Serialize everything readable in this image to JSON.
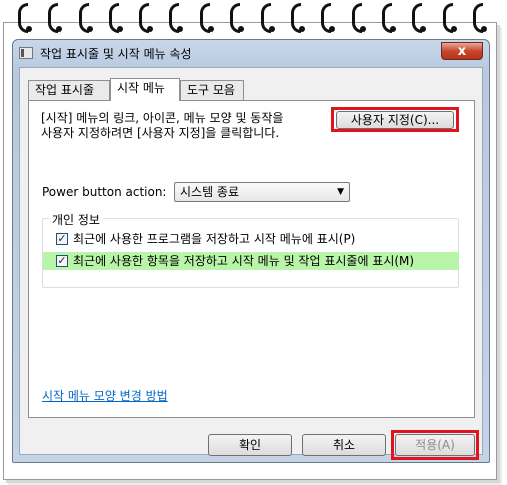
{
  "dialog": {
    "title": "작업 표시줄 및 시작 메뉴 속성",
    "close_glyph": "x"
  },
  "tabs": [
    {
      "label": "작업 표시줄"
    },
    {
      "label": "시작 메뉴"
    },
    {
      "label": "도구 모음"
    }
  ],
  "start_menu": {
    "intro_line1": "[시작] 메뉴의 링크, 아이콘, 메뉴 모양 및 동작을",
    "intro_line2": "사용자 지정하려면 [사용자 지정]을 클릭합니다.",
    "customize_button": "사용자 지정(C)...",
    "power_label": "Power button action:",
    "power_value": "시스템 종료",
    "privacy_group": "개인 정보",
    "check_recent_programs": "최근에 사용한 프로그램을 저장하고 시작 메뉴에 표시(P)",
    "check_recent_items": "최근에 사용한 항목을 저장하고 시작 메뉴 및 작업 표시줄에 표시(M)",
    "check_mark": "✓",
    "help_link": "시작 메뉴 모양 변경 방법"
  },
  "footer": {
    "ok": "확인",
    "cancel": "취소",
    "apply": "적용(A)"
  },
  "colors": {
    "highlight_red": "#e0141c",
    "highlight_green": "#b8f5a8",
    "link_blue": "#0066cc"
  }
}
